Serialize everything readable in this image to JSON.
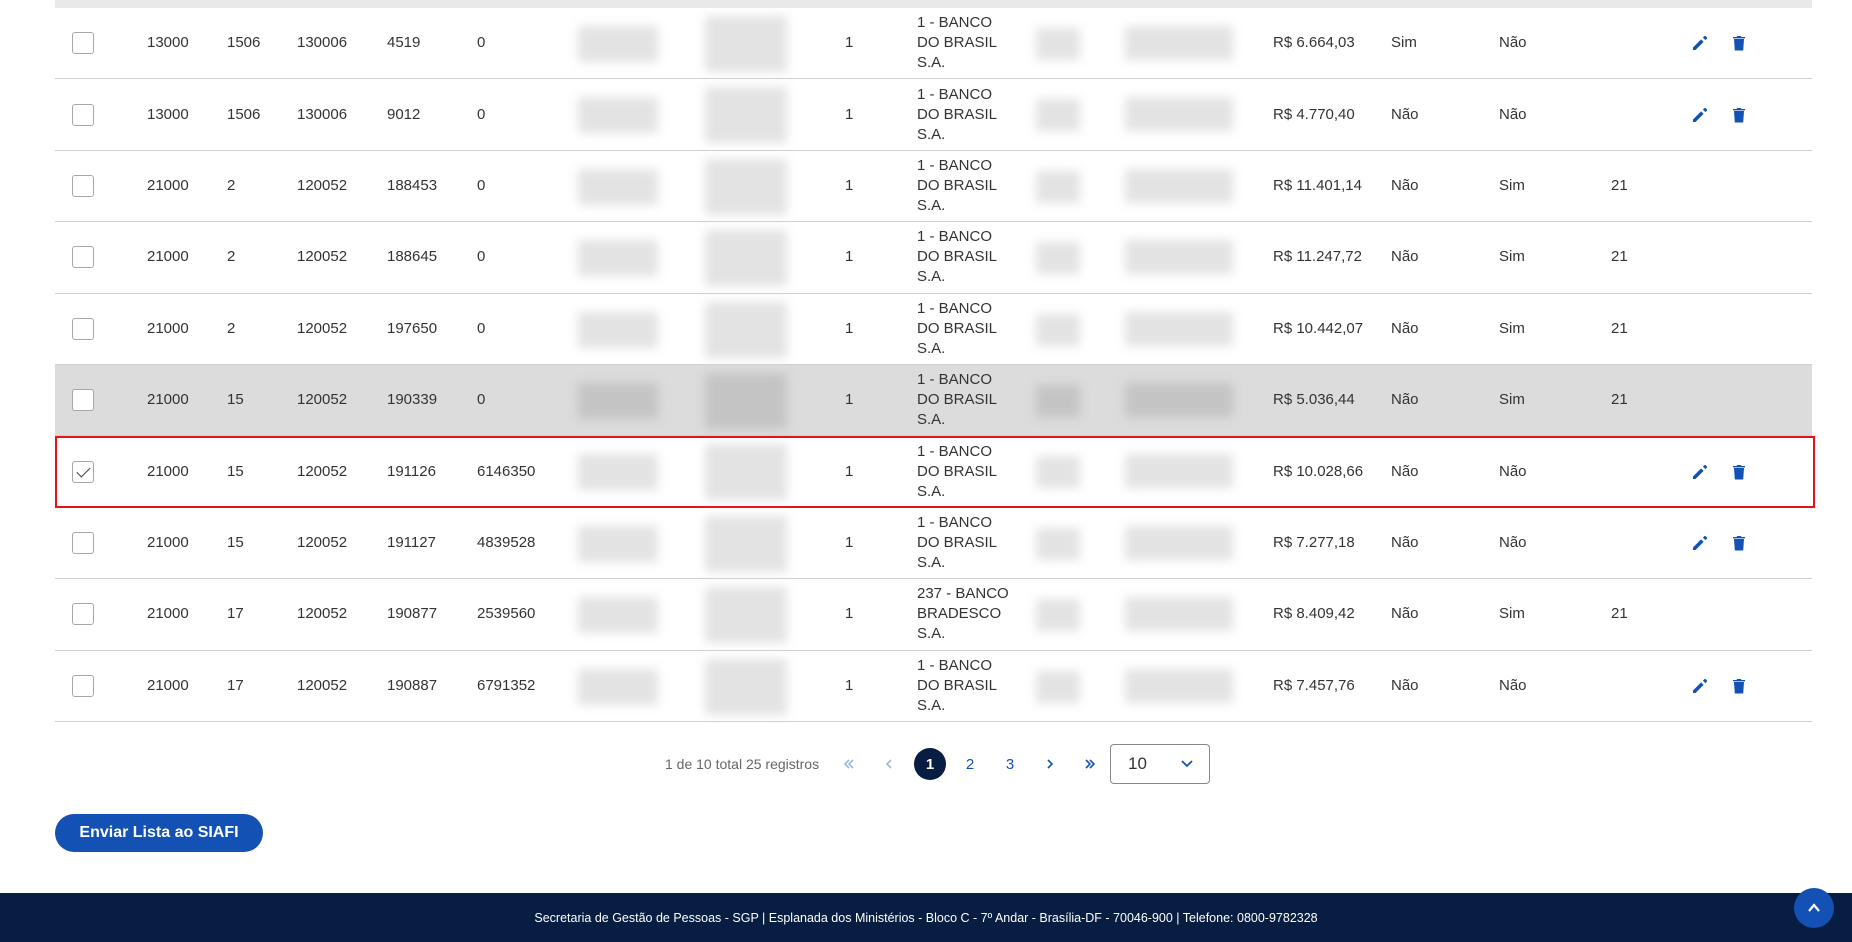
{
  "icons": {
    "edit": "pencil-icon",
    "delete": "trash-icon",
    "first": "chevron-double-left-icon",
    "prev": "chevron-left-icon",
    "next": "chevron-right-icon",
    "last": "chevron-double-right-icon",
    "dropdown": "chevron-down-icon",
    "scroll_top": "chevron-up-icon"
  },
  "colors": {
    "primary": "#1351b4",
    "footer": "#071d41",
    "selected_border": "#e3131b",
    "hover_row": "#dcdcdc"
  },
  "rows": [
    {
      "c1": "13000",
      "c2": "1506",
      "c3": "130006",
      "c4": "4519",
      "c5": "0",
      "c6": "1",
      "bank": "1 - BANCO DO BRASIL S.A.",
      "valor": "R$ 6.664,03",
      "s1": "Sim",
      "s2": "Não",
      "num": "",
      "actions": true,
      "checked": false,
      "state": ""
    },
    {
      "c1": "13000",
      "c2": "1506",
      "c3": "130006",
      "c4": "9012",
      "c5": "0",
      "c6": "1",
      "bank": "1 - BANCO DO BRASIL S.A.",
      "valor": "R$ 4.770,40",
      "s1": "Não",
      "s2": "Não",
      "num": "",
      "actions": true,
      "checked": false,
      "state": ""
    },
    {
      "c1": "21000",
      "c2": "2",
      "c3": "120052",
      "c4": "188453",
      "c5": "0",
      "c6": "1",
      "bank": "1 - BANCO DO BRASIL S.A.",
      "valor": "R$ 11.401,14",
      "s1": "Não",
      "s2": "Sim",
      "num": "21",
      "actions": false,
      "checked": false,
      "state": ""
    },
    {
      "c1": "21000",
      "c2": "2",
      "c3": "120052",
      "c4": "188645",
      "c5": "0",
      "c6": "1",
      "bank": "1 - BANCO DO BRASIL S.A.",
      "valor": "R$ 11.247,72",
      "s1": "Não",
      "s2": "Sim",
      "num": "21",
      "actions": false,
      "checked": false,
      "state": ""
    },
    {
      "c1": "21000",
      "c2": "2",
      "c3": "120052",
      "c4": "197650",
      "c5": "0",
      "c6": "1",
      "bank": "1 - BANCO DO BRASIL S.A.",
      "valor": "R$ 10.442,07",
      "s1": "Não",
      "s2": "Sim",
      "num": "21",
      "actions": false,
      "checked": false,
      "state": ""
    },
    {
      "c1": "21000",
      "c2": "15",
      "c3": "120052",
      "c4": "190339",
      "c5": "0",
      "c6": "1",
      "bank": "1 - BANCO DO BRASIL S.A.",
      "valor": "R$ 5.036,44",
      "s1": "Não",
      "s2": "Sim",
      "num": "21",
      "actions": false,
      "checked": false,
      "state": "hover"
    },
    {
      "c1": "21000",
      "c2": "15",
      "c3": "120052",
      "c4": "191126",
      "c5": "6146350",
      "c6": "1",
      "bank": "1 - BANCO DO BRASIL S.A.",
      "valor": "R$ 10.028,66",
      "s1": "Não",
      "s2": "Não",
      "num": "",
      "actions": true,
      "checked": true,
      "state": "selected"
    },
    {
      "c1": "21000",
      "c2": "15",
      "c3": "120052",
      "c4": "191127",
      "c5": "4839528",
      "c6": "1",
      "bank": "1 - BANCO DO BRASIL S.A.",
      "valor": "R$ 7.277,18",
      "s1": "Não",
      "s2": "Não",
      "num": "",
      "actions": true,
      "checked": false,
      "state": ""
    },
    {
      "c1": "21000",
      "c2": "17",
      "c3": "120052",
      "c4": "190877",
      "c5": "2539560",
      "c6": "1",
      "bank": "237 - BANCO BRADESCO S.A.",
      "valor": "R$ 8.409,42",
      "s1": "Não",
      "s2": "Sim",
      "num": "21",
      "actions": false,
      "checked": false,
      "state": ""
    },
    {
      "c1": "21000",
      "c2": "17",
      "c3": "120052",
      "c4": "190887",
      "c5": "6791352",
      "c6": "1",
      "bank": "1 - BANCO DO BRASIL S.A.",
      "valor": "R$ 7.457,76",
      "s1": "Não",
      "s2": "Não",
      "num": "",
      "actions": true,
      "checked": false,
      "state": ""
    }
  ],
  "pagination": {
    "info": "1 de 10 total 25 registros",
    "pages": [
      "1",
      "2",
      "3"
    ],
    "active_page": "1",
    "per_page": "10"
  },
  "send_button": "Enviar Lista ao SIAFI",
  "footer": "Secretaria de Gestão de Pessoas - SGP | Esplanada dos Ministérios - Bloco C - 7º Andar - Brasília-DF - 70046-900 | Telefone: 0800-9782328"
}
